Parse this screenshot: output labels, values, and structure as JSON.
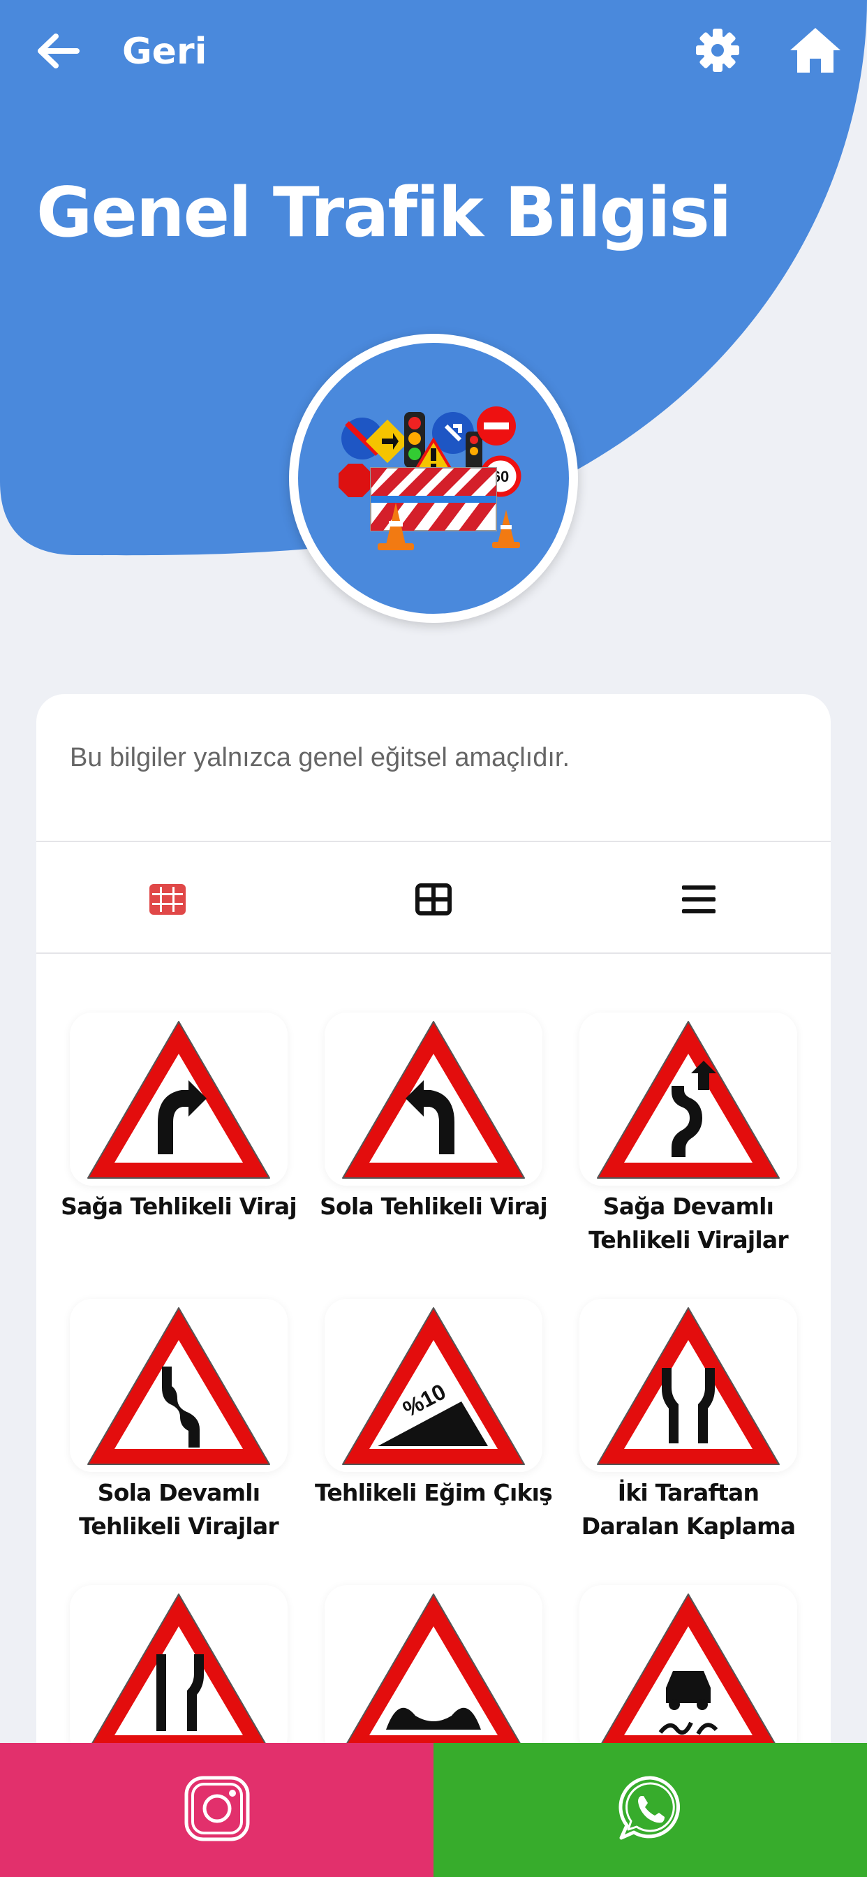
{
  "header": {
    "back_label": "Geri",
    "title": "Genel Trafik Bilgisi",
    "brand_color": "#4a89dc"
  },
  "hero": {
    "icon": "traffic-signs-illustration"
  },
  "card": {
    "disclaimer": "Bu bilgiler yalnızca genel eğitsel amaçlıdır.",
    "view_toggle": {
      "active": "grid-3",
      "active_color": "#e04848",
      "options": [
        "grid-3",
        "grid-2",
        "list"
      ]
    },
    "signs": [
      {
        "label": "Sağa Tehlikeli Viraj",
        "icon": "right-curve-sign-icon"
      },
      {
        "label": "Sola Tehlikeli Viraj",
        "icon": "left-curve-sign-icon"
      },
      {
        "label": "Sağa Devamlı Tehlikeli Virajlar",
        "icon": "double-curve-right-sign-icon"
      },
      {
        "label": "Sola Devamlı Tehlikeli Virajlar",
        "icon": "double-curve-left-sign-icon"
      },
      {
        "label": "Tehlikeli Eğim Çıkış",
        "icon": "steep-ascent-sign-icon",
        "sign_text": "%10"
      },
      {
        "label": "İki Taraftan Daralan Kaplama",
        "icon": "road-narrows-both-sign-icon"
      },
      {
        "label": "",
        "icon": "road-narrows-right-sign-icon"
      },
      {
        "label": "",
        "icon": "bumpy-road-sign-icon"
      },
      {
        "label": "",
        "icon": "slippery-road-sign-icon"
      }
    ]
  },
  "bottom_bar": {
    "instagram_icon": "instagram-icon",
    "instagram_color": "#e2306c",
    "whatsapp_icon": "whatsapp-icon",
    "whatsapp_color": "#37ac2c"
  }
}
